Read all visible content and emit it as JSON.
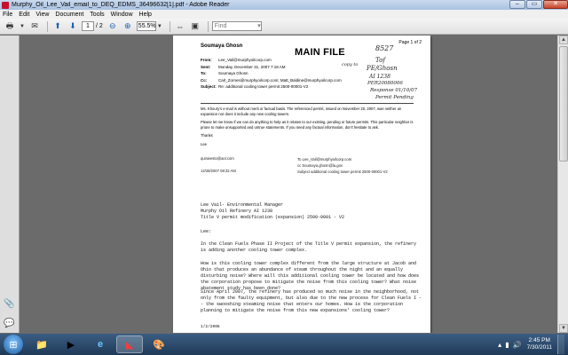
{
  "window": {
    "title": "Murphy_Oil_Lee_Vail_email_to_DEQ_EDMS_36496632[1].pdf - Adobe Reader",
    "buttons": {
      "minimize": "–",
      "maximize": "▭",
      "close": "✕"
    }
  },
  "menu": {
    "items": [
      "File",
      "Edit",
      "View",
      "Document",
      "Tools",
      "Window",
      "Help"
    ]
  },
  "toolbar": {
    "page_current": "1",
    "page_total": "/ 2",
    "zoom": "55.5%",
    "find_placeholder": "Find"
  },
  "document": {
    "page_label": "Page 1 of 2",
    "sender_name": "Soumaya Ghosn",
    "stamp": "MAIN FILE",
    "handwritten": {
      "number": "8527",
      "copy_label": "copy to",
      "copy_to": "Tof",
      "line2": "PE/Ghosn",
      "line3": "AI 1238",
      "line4": "PER20080006",
      "line5": "Response 01/10/07",
      "line6": "Permit Pending"
    },
    "header_rows": [
      {
        "key": "From:",
        "value": "Lee_Vail@murphyoilcorp.com"
      },
      {
        "key": "Sent:",
        "value": "Monday, December 31, 2007 7:18 AM"
      },
      {
        "key": "To:",
        "value": "Soumaya Ghosn"
      },
      {
        "key": "Cc:",
        "value": "Carl_Zornes@murphyoilcorp.com; Matt_Baldine@murphyoilcorp.com"
      },
      {
        "key": "Subject:",
        "value": "Re: additional cooling tower permit 2500-00001-V2"
      }
    ],
    "body_p1": "Ms. Khoury's e-mail is without merit or factual basis. The referenced permit, issued on November 20, 2007, was neither an expansion nor does it include any new cooling towers.",
    "body_p2": "Please let me know if we can do anything to help as it relates to our existing, pending or future permits. This particular neighbor is prone to make unsupported and untrue statements. If you need any factual information, don't hesitate to ask.",
    "body_thanks": "Thanks",
    "body_lee": "Lee",
    "sig_left_email": "quinwesto@aol.com",
    "sig_left_date": "12/28/2007 08:32 AM",
    "sig_right_to": "To  Lee_Vail@murphyoilcorp.com",
    "sig_right_cc": "cc  Soumaya.ghosn@la.gov",
    "sig_right_subject": "Subject  additional cooling tower permit 2500-00001-V2",
    "typed_to": "Lee Vail- Environmental Manager",
    "typed_company": "Murphy Oil Refinery  AI 1238",
    "typed_title": "Title V permit modification (expansion) 2500-0001 - V2",
    "typed_greeting": "Lee:",
    "typed_p1": "In the Clean Fuels Phase II Project of the Title V permit expansion, the refinery is adding another cooling tower complex.",
    "typed_p2": "How is this cooling tower complex different from the large structure at Jacob and Ohio that produces an abundance of steam throughout the night and an equally disturbing noise? Where will this additional cooling tower be located and how does the corporation propose to mitigate the noise from this cooling tower? What noise abatement study has been done?",
    "typed_p3": "Since April 2007, the refinery has produced so much noise in the neighborhood, not only from the faulty equipment, but also due to the new process for Clean Fuels I -- the swooshing steaming noise that enters our homes. How is the corporation planning to mitigate the noise from this new expansions' cooling tower?",
    "typed_footer": "1/2/2008"
  },
  "taskbar": {
    "start_glyph": "⊞",
    "clock_time": "2:45 PM",
    "clock_date": "7/30/2011"
  }
}
